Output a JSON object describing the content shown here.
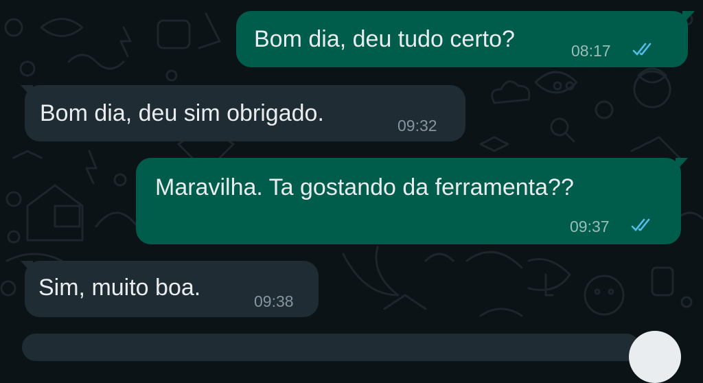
{
  "messages": [
    {
      "direction": "outgoing",
      "text": "Bom dia, deu tudo certo?",
      "time": "08:17",
      "status": "read"
    },
    {
      "direction": "incoming",
      "text": "Bom dia, deu sim obrigado.",
      "time": "09:32"
    },
    {
      "direction": "outgoing",
      "text": "Maravilha.  Ta gostando da ferramenta??",
      "time": "09:37",
      "status": "read"
    },
    {
      "direction": "incoming",
      "text": "Sim, muito boa.",
      "time": "09:38"
    }
  ],
  "colors": {
    "background": "#0c1317",
    "incoming_bubble": "#1f2c33",
    "outgoing_bubble": "#005c4b",
    "message_text": "#e9edef",
    "timestamp": "#8696a0",
    "read_ticks": "#53bdeb"
  },
  "icons": [
    "double-check-icon",
    "floating-action-button"
  ]
}
